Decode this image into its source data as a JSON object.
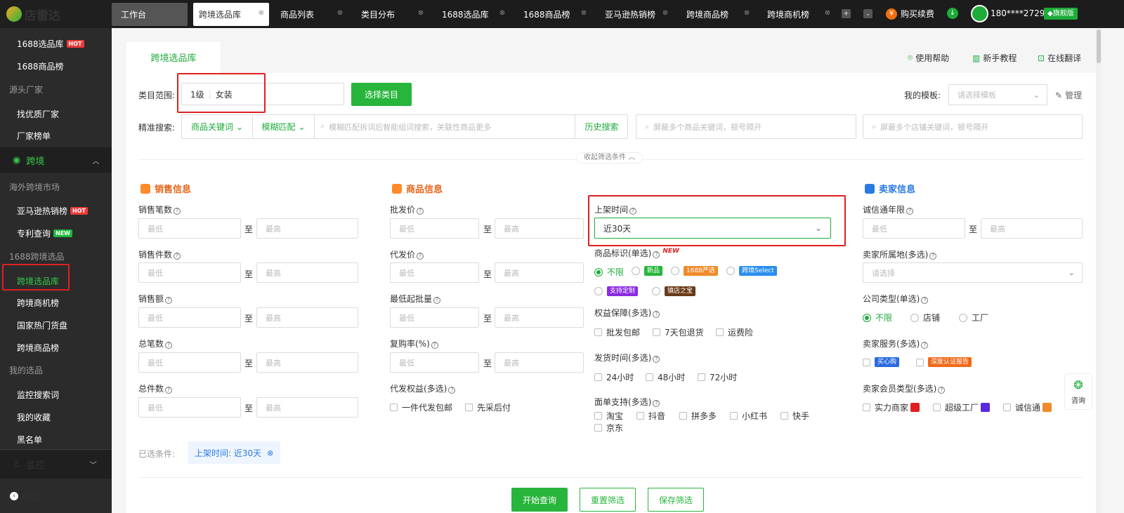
{
  "app": {
    "name": "店雷达"
  },
  "sidebar": {
    "items": [
      {
        "label": "1688选品库",
        "badge": "HOT"
      },
      {
        "label": "1688商品榜"
      },
      {
        "label": "源头厂家",
        "group": true
      },
      {
        "label": "找优质厂家"
      },
      {
        "label": "厂家榜单"
      },
      {
        "label": "跨境"
      },
      {
        "label": "海外跨境市场",
        "group": true
      },
      {
        "label": "亚马逊热销榜",
        "badge": "HOT"
      },
      {
        "label": "专利查询",
        "badge": "NEW"
      },
      {
        "label": "1688跨境选品",
        "group": true
      },
      {
        "label": "跨境选品库"
      },
      {
        "label": "跨境商机榜"
      },
      {
        "label": "国家热门货盘"
      },
      {
        "label": "跨境商品榜"
      },
      {
        "label": "我的选品",
        "group": true
      },
      {
        "label": "监控搜索词"
      },
      {
        "label": "我的收藏"
      },
      {
        "label": "黑名单"
      },
      {
        "label": "监控"
      },
      {
        "label": "收起"
      }
    ]
  },
  "tabs": [
    {
      "label": "工作台"
    },
    {
      "label": "跨境选品库"
    },
    {
      "label": "商品列表"
    },
    {
      "label": "类目分布"
    },
    {
      "label": "1688选品库"
    },
    {
      "label": "1688商品榜"
    },
    {
      "label": "亚马逊热销榜"
    },
    {
      "label": "跨境商品榜"
    },
    {
      "label": "跨境商机榜"
    }
  ],
  "topbar": {
    "buy_label": "购买续费",
    "phone": "180****2729",
    "vip": "旗舰版"
  },
  "card": {
    "tab": "跨境选品库",
    "help": "使用帮助",
    "tutorial": "新手教程",
    "translate": "在线翻译",
    "category_label": "类目范围:",
    "category_level": "1级",
    "category_value": "女装",
    "choose_category": "选择类目",
    "template_label": "我的模板:",
    "template_placeholder": "请选择模板",
    "manage": "管理",
    "search_label": "精准搜索:",
    "keyword_type": "商品关键词",
    "match_type": "模糊匹配",
    "search_placeholder": "模糊匹配拆词后智能组词搜索，关联性商品更多",
    "history": "历史搜索",
    "block_goods_placeholder": "屏蔽多个商品关键词，顿号隔开",
    "block_shop_placeholder": "屏蔽多个店铺关键词，顿号隔开",
    "collapse": "收起筛选条件",
    "min": "最低",
    "max": "最高",
    "to": "至"
  },
  "sales": {
    "title": "销售信息",
    "fields": [
      "销售笔数",
      "销售件数",
      "销售额",
      "总笔数",
      "总件数"
    ]
  },
  "goods": {
    "title": "商品信息",
    "fields": [
      "批发价",
      "代发价",
      "最低起批量",
      "复购率(%)"
    ],
    "daifa_label": "代发权益(多选)",
    "daifa_options": [
      "一件代发包邮",
      "先采后付"
    ]
  },
  "middle": {
    "listing_label": "上架时间",
    "listing_value": "近30天",
    "mark_label": "商品标识(单选)",
    "mark_new": "NEW",
    "mark_options": [
      "不限",
      "新品",
      "1688严选",
      "跨境Select",
      "支持定制",
      "镇店之宝"
    ],
    "rights_label": "权益保障(多选)",
    "rights_options": [
      "批发包邮",
      "7天包退货",
      "运费险"
    ],
    "ship_label": "发货时间(多选)",
    "ship_options": [
      "24小时",
      "48小时",
      "72小时"
    ],
    "waybill_label": "面单支持(多选)",
    "waybill_options": [
      "淘宝",
      "抖音",
      "拼多多",
      "小红书",
      "快手",
      "京东"
    ]
  },
  "seller": {
    "title": "卖家信息",
    "cxt_label": "诚信通年限",
    "region_label": "卖家所属地(多选)",
    "region_placeholder": "请选择",
    "company_label": "公司类型(单选)",
    "company_options": [
      "不限",
      "店铺",
      "工厂"
    ],
    "service_label": "卖家服务(多选)",
    "service_options": [
      "买心购",
      "深度认证报告"
    ],
    "member_label": "卖家会员类型(多选)",
    "member_options": [
      "实力商家",
      "超级工厂",
      "诚信通"
    ]
  },
  "selected": {
    "label": "已选条件:",
    "chip": "上架时间:  近30天"
  },
  "actions": {
    "query": "开始查询",
    "reset": "重置筛选",
    "save": "保存筛选"
  },
  "consult": "咨询",
  "colors": {
    "accent": "#1dab3a",
    "highlight": "#e02020",
    "orange": "#e8651a",
    "blue": "#2a7ae2"
  }
}
